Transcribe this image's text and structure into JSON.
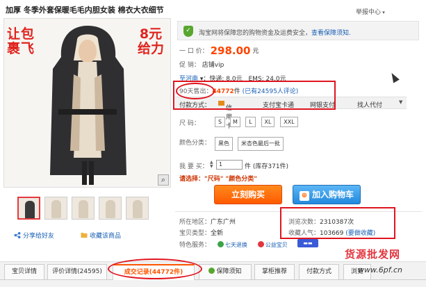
{
  "title": "加厚 冬季外套保暖毛毛内胆女装 棉衣大衣细节",
  "report": "举报中心",
  "promo": {
    "left": "让包\n裹飞",
    "right": "8元\n给力"
  },
  "zoom_icon": "magnifier-icon",
  "share": "分享给好友",
  "favorite": "收藏该商品",
  "notice": {
    "text": "淘宝网将保障您的购物资金及运费安全，",
    "link": "查看保障须知."
  },
  "price": {
    "label": "一 口 价：",
    "value": "298.00",
    "unit": "元"
  },
  "promotion": {
    "label": "促     销：",
    "value": "店铺vip"
  },
  "shipping": {
    "dest": "至河南",
    "express": "▾：快递: 8.0元",
    "ems": "EMS: 24.0元"
  },
  "sales": {
    "label": "90天售出：",
    "count": "44772",
    "unit": "件",
    "reviews": "(已有24595人评论)"
  },
  "payment": {
    "label": "付款方式：",
    "options": [
      "信用卡",
      "支付宝卡通",
      "网银支付",
      "找人代付"
    ]
  },
  "size": {
    "label": "尺     码：",
    "options": [
      "S",
      "M",
      "L",
      "XL",
      "XXL"
    ]
  },
  "color": {
    "label": "颜色分类：",
    "options": [
      "黑色",
      "米杏色最后一批"
    ]
  },
  "quantity": {
    "label": "我 要 买：",
    "value": "1",
    "unit": "件 (库存371件)"
  },
  "choose_prompt": "请选择：\"尺码\" \"颜色分类\"",
  "buttons": {
    "buy": "立刻购买",
    "cart": "加入购物车"
  },
  "location": {
    "label": "所在地区：",
    "value": "广东广州"
  },
  "condition": {
    "label": "宝贝类型：",
    "value": "全新"
  },
  "services": {
    "label": "特色服务：",
    "items": [
      "七天退换",
      "公益宝贝"
    ]
  },
  "views": {
    "label": "浏览次数：",
    "value": "2310387次"
  },
  "popularity": {
    "label": "收藏人气：",
    "value": "103669",
    "link": "(要做收藏)"
  },
  "tabs": [
    {
      "label": "宝贝详情"
    },
    {
      "label": "评价详情(24595)"
    },
    {
      "label": "成交记录(44772件)"
    },
    {
      "label": "保障须知"
    },
    {
      "label": "掌柜推荐"
    },
    {
      "label": "付款方式"
    },
    {
      "label": "浏览"
    }
  ],
  "watermark": {
    "cn": "货源批发网",
    "url": "www.6pf.cn"
  },
  "colors": {
    "accent": "#ff4400",
    "link": "#1a5fb4",
    "annotation": "#e0141e"
  }
}
